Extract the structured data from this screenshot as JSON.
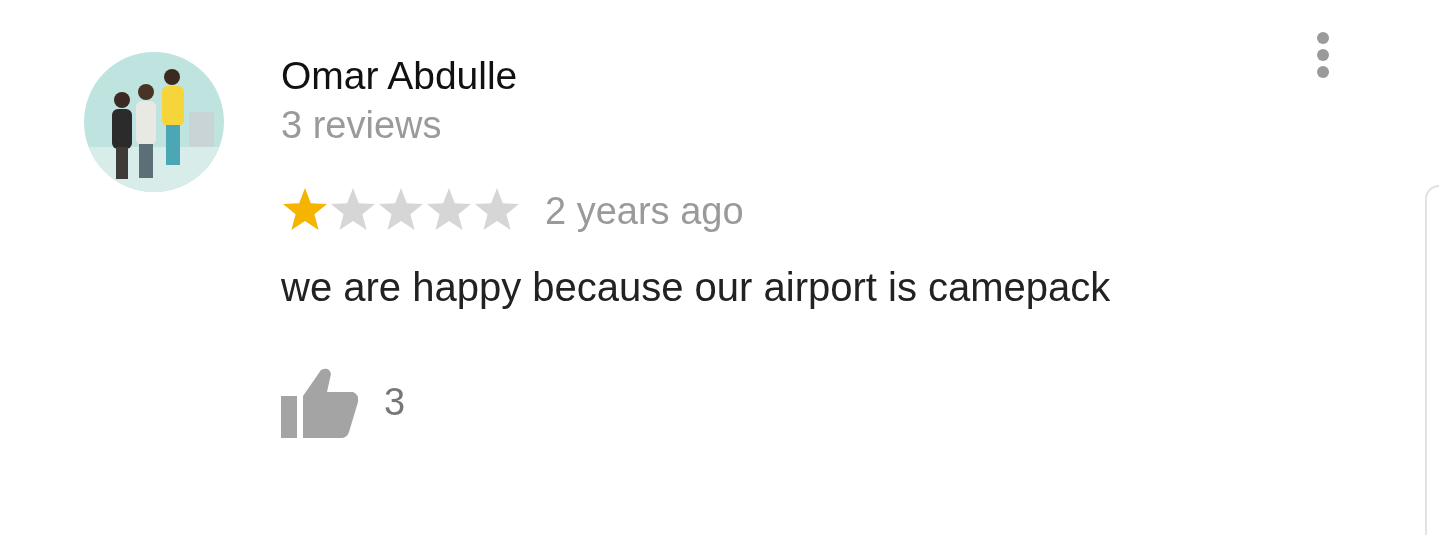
{
  "review": {
    "author": "Omar Abdulle",
    "author_reviews": "3 reviews",
    "stars": 1,
    "time": "2 years ago",
    "text": "we are happy because our airport is camepack",
    "likes": "3"
  }
}
